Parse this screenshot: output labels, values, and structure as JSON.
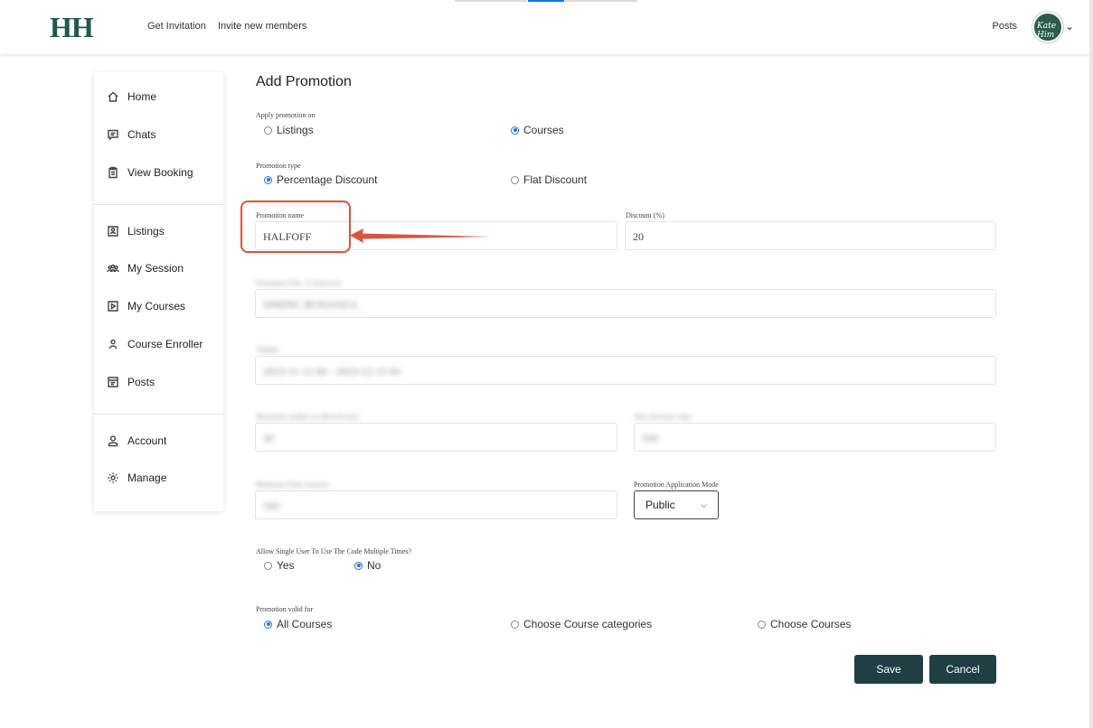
{
  "header": {
    "logo": "HH",
    "nav": [
      "Get Invitation",
      "Invite new members"
    ],
    "posts": "Posts",
    "avatar_text": "Kate Him"
  },
  "sidebar": {
    "group1": [
      "Home",
      "Chats",
      "View Booking"
    ],
    "group2": [
      "Listings",
      "My Session",
      "My Courses",
      "Course Enroller",
      "Posts"
    ],
    "group3": [
      "Account",
      "Manage"
    ]
  },
  "form": {
    "title": "Add Promotion",
    "apply_on": {
      "label": "Apply promotion on",
      "options": [
        "Listings",
        "Courses"
      ],
      "selected": "Courses"
    },
    "promotion_type": {
      "label": "Promotion type",
      "options": [
        "Percentage Discount",
        "Flat Discount"
      ],
      "selected": "Percentage Discount"
    },
    "promotion_name": {
      "label": "Promotion name",
      "value": "HALFOFF"
    },
    "discount": {
      "label": "Discount (%)",
      "value": "20"
    },
    "blurred": {
      "field1_label": "Promotion Title / E-Interview",
      "field1_value": "SPRING BONANZA",
      "field2_label": "Validity",
      "field2_value": "2023-11-12 00 - 2023-12-15 00",
      "field3_label": "Maximum number of allowed users",
      "field3_value": "20",
      "field4_label": "Max discount value",
      "field4_value": "500",
      "field5_label": "Minimum Order Amount",
      "field5_value": "500"
    },
    "application_mode": {
      "label": "Promotion Application Mode",
      "value": "Public"
    },
    "multi_use": {
      "label": "Allow Single User To Use The Code Multiple Times?",
      "options": [
        "Yes",
        "No"
      ],
      "selected": "No"
    },
    "valid_for": {
      "label": "Promotion valid for",
      "options": [
        "All Courses",
        "Choose Course categories",
        "Choose Courses"
      ],
      "selected": "All Courses"
    },
    "save_label": "Save",
    "cancel_label": "Cancel"
  },
  "colors": {
    "brand": "#1f5a4a",
    "button": "#1f3f45",
    "highlight": "#d9543f",
    "radio": "#1a73e8"
  }
}
